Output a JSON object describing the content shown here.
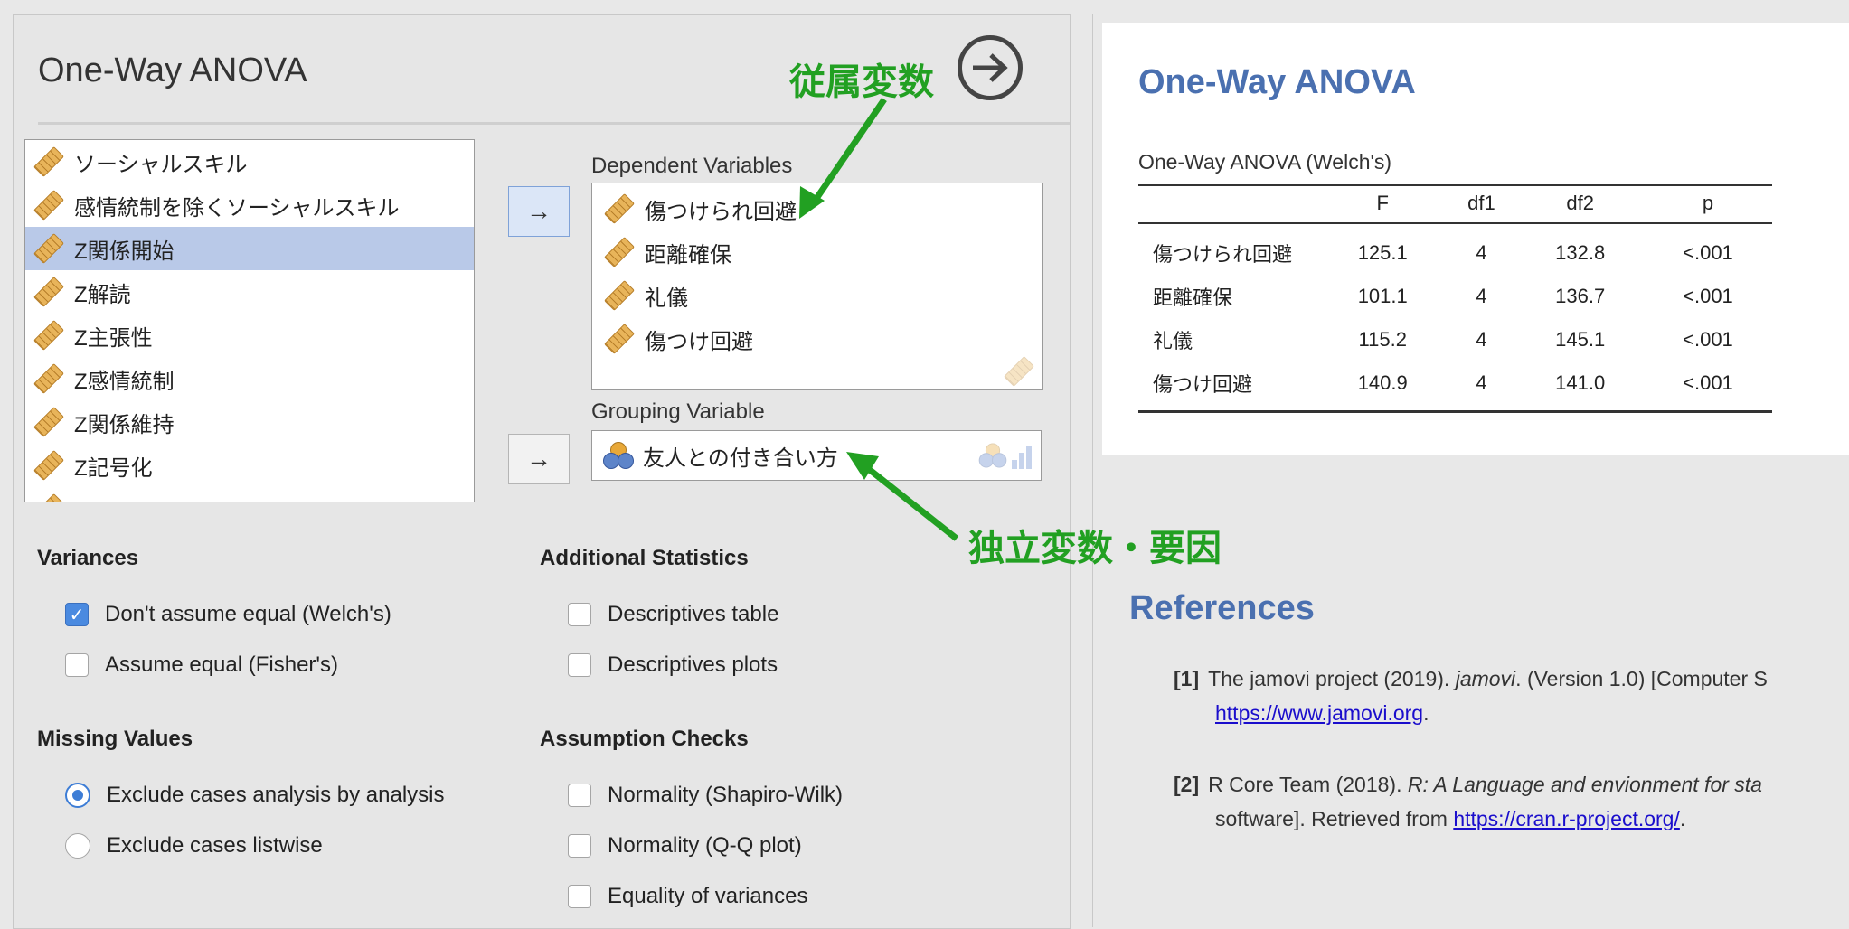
{
  "analysis": {
    "title": "One-Way ANOVA",
    "variables": [
      "ソーシャルスキル",
      "感情統制を除くソーシャルスキル",
      "Z関係開始",
      "Z解読",
      "Z主張性",
      "Z感情統制",
      "Z関係維持",
      "Z記号化"
    ],
    "selected_variable": "Z関係開始",
    "dependent_label": "Dependent Variables",
    "dependent_variables": [
      "傷つけられ回避",
      "距離確保",
      "礼儀",
      "傷つけ回避"
    ],
    "grouping_label": "Grouping Variable",
    "grouping_variable": "友人との付き合い方",
    "arrow_glyph": "→",
    "variances": {
      "heading": "Variances",
      "welch": {
        "label": "Don't assume equal (Welch's)",
        "checked": true
      },
      "fisher": {
        "label": "Assume equal (Fisher's)",
        "checked": false
      }
    },
    "missing": {
      "heading": "Missing Values",
      "analysis": {
        "label": "Exclude cases analysis by analysis",
        "selected": true
      },
      "listwise": {
        "label": "Exclude cases listwise",
        "selected": false
      }
    },
    "additional": {
      "heading": "Additional Statistics",
      "descriptives_table": {
        "label": "Descriptives table",
        "checked": false
      },
      "descriptives_plots": {
        "label": "Descriptives plots",
        "checked": false
      }
    },
    "assumptions": {
      "heading": "Assumption Checks",
      "shapiro": {
        "label": "Normality (Shapiro-Wilk)",
        "checked": false
      },
      "qq": {
        "label": "Normality (Q-Q plot)",
        "checked": false
      },
      "equality": {
        "label": "Equality of variances",
        "checked": false
      }
    }
  },
  "annotations": {
    "dependent": "従属変数",
    "independent": "独立変数・要因"
  },
  "results": {
    "title": "One-Way ANOVA",
    "table_title": "One-Way ANOVA (Welch's)",
    "columns": [
      "",
      "F",
      "df1",
      "df2",
      "p"
    ],
    "rows": [
      [
        "傷つけられ回避",
        "125.1",
        "4",
        "132.8",
        "<.001"
      ],
      [
        "距離確保",
        "101.1",
        "4",
        "136.7",
        "<.001"
      ],
      [
        "礼儀",
        "115.2",
        "4",
        "145.1",
        "<.001"
      ],
      [
        "傷つけ回避",
        "140.9",
        "4",
        "141.0",
        "<.001"
      ]
    ],
    "references_title": "References",
    "ref1": {
      "num": "[1]",
      "pre": "The jamovi project (2019). ",
      "italic": "jamovi",
      "post": ". (Version 1.0) [Computer S",
      "link": "https://www.jamovi.org",
      "tail": "."
    },
    "ref2": {
      "num": "[2]",
      "pre": "R Core Team (2018). ",
      "italic": "R: A Language and envionment for sta",
      "line2": "software]. Retrieved from ",
      "link": "https://cran.r-project.org/",
      "tail": "."
    }
  },
  "colors": {
    "annotation": "#22a022",
    "heading_blue": "#4a70b0",
    "selected_row": "#b9c9e8",
    "checkbox_on": "#4a8ae0"
  }
}
